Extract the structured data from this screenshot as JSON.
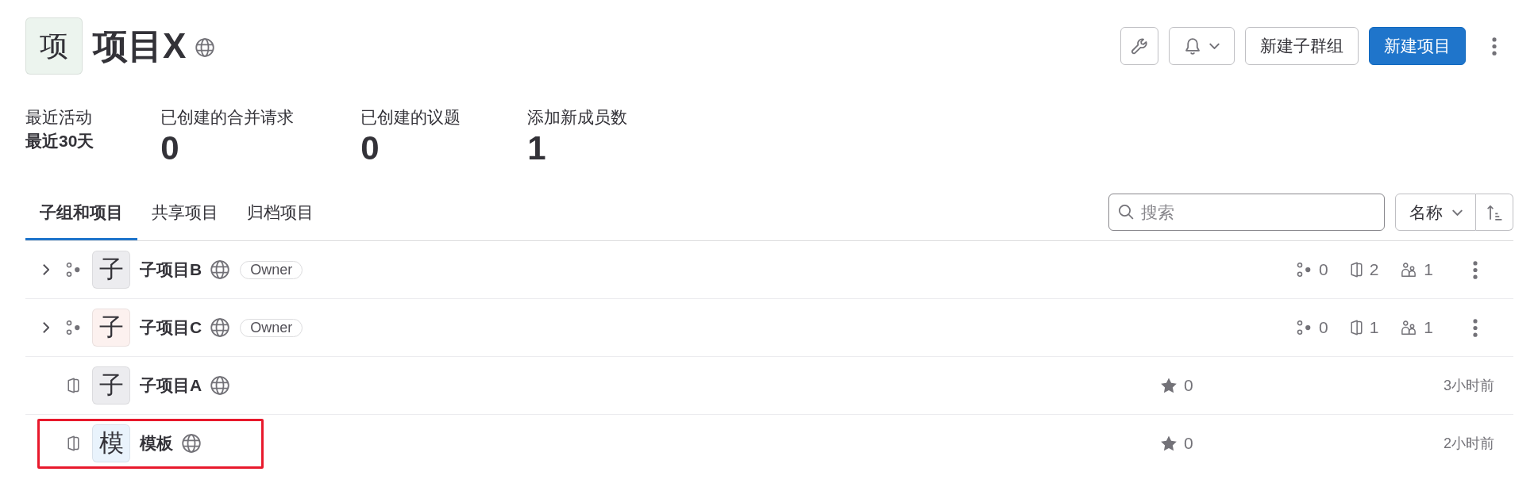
{
  "header": {
    "avatar": "项",
    "color": "#ecf4ee",
    "title": "项目X"
  },
  "buttons": [
    {
      "label": "新建子群组",
      "primary": false
    },
    {
      "label": "新建项目",
      "primary": true
    }
  ],
  "stats": [
    {
      "kind": "period",
      "label": "最近活动",
      "value": "最近30天"
    },
    {
      "kind": "count",
      "label": "已创建的合并请求",
      "value": "0"
    },
    {
      "kind": "count",
      "label": "已创建的议题",
      "value": "0"
    },
    {
      "kind": "count",
      "label": "添加新成员数",
      "value": "1"
    }
  ],
  "tabs": [
    {
      "label": "子组和项目",
      "selected": true
    },
    {
      "label": "共享项目",
      "selected": false
    },
    {
      "label": "归档项目",
      "selected": false
    }
  ],
  "search": {
    "placeholder": "搜索"
  },
  "sort": {
    "label": "名称"
  },
  "rows": [
    {
      "kind": "group",
      "expanded": false,
      "avatar": "子",
      "color": "#ececef",
      "name": "子项目B",
      "badge": "Owner",
      "subgroups": "0",
      "projects": "2",
      "members": "1",
      "highlighted": false
    },
    {
      "kind": "group",
      "expanded": false,
      "avatar": "子",
      "color": "#fcf1ef",
      "name": "子项目C",
      "badge": "Owner",
      "subgroups": "0",
      "projects": "1",
      "members": "1",
      "highlighted": false
    },
    {
      "kind": "project",
      "avatar": "子",
      "color": "#ececef",
      "name": "子项目A",
      "star_count": "0",
      "updated": "3小时前",
      "highlighted": false
    },
    {
      "kind": "project",
      "avatar": "模",
      "color": "#e9f3fc",
      "name": "模板",
      "star_count": "0",
      "updated": "2小时前",
      "highlighted": true
    }
  ]
}
